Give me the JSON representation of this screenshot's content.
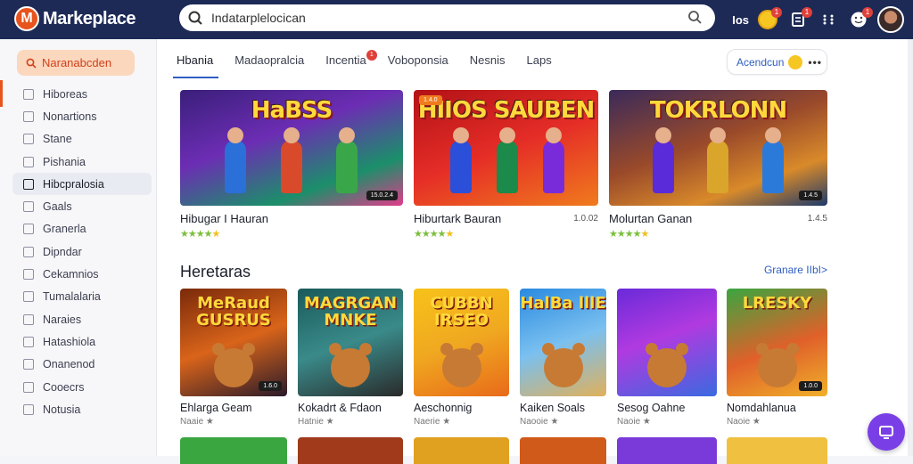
{
  "app": {
    "name": "Markeplace",
    "logo_letter": "M"
  },
  "search": {
    "value": "Indatarplelocican",
    "placeholder": ""
  },
  "topbar": {
    "lang": "Ios",
    "badges": [
      "1",
      "1",
      "1"
    ]
  },
  "sidebar": {
    "cta_label": "Naranabcden",
    "items": [
      {
        "label": "Hiboreas"
      },
      {
        "label": "Nonartions"
      },
      {
        "label": "Stane"
      },
      {
        "label": "Pishania"
      },
      {
        "label": "Hibcpralosia",
        "active": true
      },
      {
        "label": "Gaals"
      },
      {
        "label": "Granerla"
      },
      {
        "label": "Dipndar"
      },
      {
        "label": "Cekamnios"
      },
      {
        "label": "Tumalalaria"
      },
      {
        "label": "Naraies"
      },
      {
        "label": "Hatashiola"
      },
      {
        "label": "Onanenod"
      },
      {
        "label": "Cooecrs"
      },
      {
        "label": "Notusia"
      }
    ]
  },
  "tabs": [
    {
      "label": "Hbania",
      "active": true
    },
    {
      "label": "Madaopralcia"
    },
    {
      "label": "Incentia",
      "badge": "1"
    },
    {
      "label": "Voboponsia"
    },
    {
      "label": "Nesnis"
    },
    {
      "label": "Laps"
    }
  ],
  "account": {
    "label": "Acendcun",
    "more": "•••"
  },
  "featured": [
    {
      "title": "Hibugar I Hauran",
      "meta": "",
      "image_text": "HaBSS",
      "tag": "15.0.2.4",
      "stars": 4.5
    },
    {
      "title": "Hiburtark Bauran",
      "meta": "1.0.02",
      "image_text": "HIIOS SAUBEN",
      "tag": "",
      "badge": "1.4.0",
      "stars": 4.5
    },
    {
      "title": "Molurtan Ganan",
      "meta": "1.4.5",
      "image_text": "TOKRLONN",
      "tag": "1.4.5",
      "stars": 4.5
    }
  ],
  "section": {
    "title": "Heretaras",
    "link": "Granare IIbI>"
  },
  "games": [
    {
      "title": "Ehlarga Geam",
      "sub": "Naaie ★",
      "image_text": "MeRaud GUSRUS",
      "tag": "1.6.0"
    },
    {
      "title": "Kokadrt & Fdaon",
      "sub": "Hatnie ★",
      "image_text": "MAGRGAN MNKE",
      "tag": ""
    },
    {
      "title": "Aeschonnig",
      "sub": "Naerie ★",
      "image_text": "CUBBN IRSEO",
      "tag": ""
    },
    {
      "title": "Kaiken Soals",
      "sub": "Naooie ★",
      "image_text": "HalBa lllE",
      "tag": ""
    },
    {
      "title": "Sesog Oahne",
      "sub": "Naoie ★",
      "image_text": "",
      "tag": ""
    },
    {
      "title": "Nomdahlanua",
      "sub": "Naoie ★",
      "image_text": "LRESKY",
      "tag": "1.0.0"
    }
  ],
  "colors": {
    "topbar": "#1d2a56",
    "accent": "#e8541d",
    "link": "#2f5ec0",
    "fab": "#7a3ee6"
  }
}
